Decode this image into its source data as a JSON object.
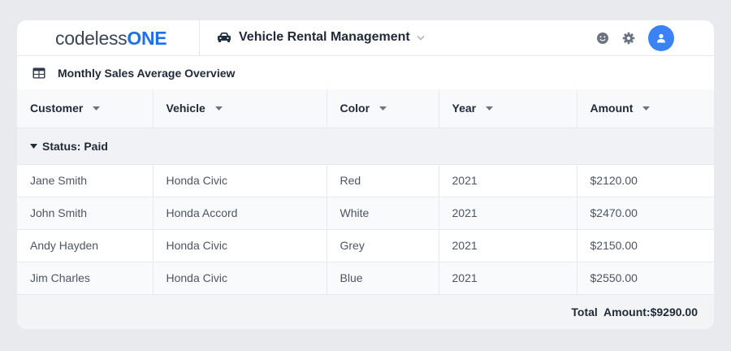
{
  "brand": {
    "logo_part1": "codeless",
    "logo_part2": "ONE"
  },
  "app": {
    "title": "Vehicle Rental Management"
  },
  "section": {
    "title": "Monthly Sales Average Overview"
  },
  "table": {
    "columns": [
      "Customer",
      "Vehicle",
      "Color",
      "Year",
      "Amount"
    ],
    "group_label": "Status: Paid",
    "rows": [
      [
        "Jane Smith",
        "Honda Civic",
        "Red",
        "2021",
        "$2120.00"
      ],
      [
        "John Smith",
        "Honda Accord",
        "White",
        "2021",
        "$2470.00"
      ],
      [
        "Andy Hayden",
        "Honda Civic",
        "Grey",
        "2021",
        "$2150.00"
      ],
      [
        "Jim Charles",
        "Honda Civic",
        "Blue",
        "2021",
        "$2550.00"
      ]
    ],
    "total_label": "Total  Amount:",
    "total_value": "$9290.00"
  },
  "icons": {
    "app": "car-icon",
    "section": "table-icon",
    "top_right": [
      "smiley-icon",
      "gear-icon",
      "user-avatar-icon"
    ]
  },
  "colors": {
    "accent": "#1f6fe6",
    "avatar": "#3b82f6"
  }
}
